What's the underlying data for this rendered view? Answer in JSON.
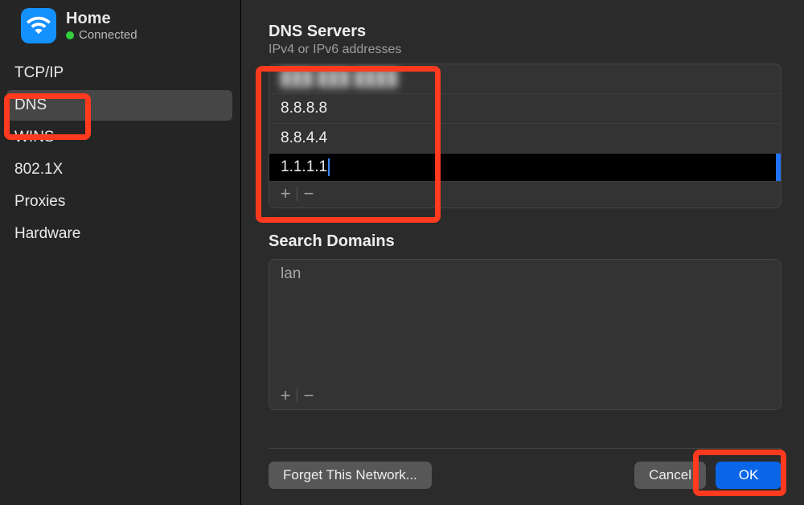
{
  "network": {
    "name": "Home",
    "status": "Connected"
  },
  "sidebar": {
    "items": [
      {
        "label": "TCP/IP"
      },
      {
        "label": "DNS",
        "selected": true
      },
      {
        "label": "WINS"
      },
      {
        "label": "802.1X"
      },
      {
        "label": "Proxies"
      },
      {
        "label": "Hardware"
      }
    ]
  },
  "dns": {
    "title": "DNS Servers",
    "subtitle": "IPv4 or IPv6 addresses",
    "servers": [
      {
        "value": "███ ███ ████",
        "blurred": true
      },
      {
        "value": "8.8.8.8"
      },
      {
        "value": "8.8.4.4"
      },
      {
        "value": "1.1.1.1",
        "editing": true
      }
    ],
    "add_label": "+",
    "remove_label": "−"
  },
  "search_domains": {
    "title": "Search Domains",
    "items": [
      {
        "value": "lan"
      }
    ],
    "add_label": "+",
    "remove_label": "−"
  },
  "actions": {
    "forget": "Forget This Network...",
    "cancel": "Cancel",
    "ok": "OK"
  }
}
